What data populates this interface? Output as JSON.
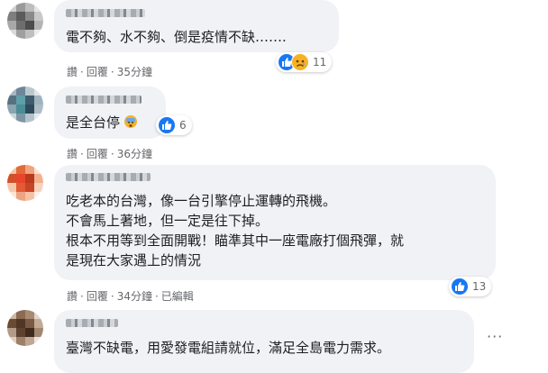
{
  "comments": [
    {
      "text_lines": [
        "電不夠、水不夠、倒是疫情不缺……."
      ],
      "actions": [
        "讚",
        "回覆",
        "35分鐘"
      ],
      "reaction_count": "11",
      "reaction_icons": [
        "like-icon",
        "sad-icon"
      ]
    },
    {
      "text_lines": [
        "是全台停"
      ],
      "inline_emoji": "wow-icon",
      "actions": [
        "讚",
        "回覆",
        "36分鐘"
      ],
      "reaction_count": "6",
      "reaction_icons": [
        "like-icon"
      ]
    },
    {
      "text_lines": [
        "吃老本的台灣，像一台引擎停止運轉的飛機。",
        "不會馬上著地，但一定是往下掉。",
        "根本不用等到全面開戰！瞄準其中一座電廠打個飛彈，就",
        "是現在大家遇上的情況"
      ],
      "actions": [
        "讚",
        "回覆",
        "34分鐘",
        "已編輯"
      ],
      "reaction_count": "13",
      "reaction_icons": [
        "like-icon"
      ]
    },
    {
      "text_lines": [
        "臺灣不缺電，用愛發電組請就位，滿足全島電力需求。"
      ],
      "more_label": "···"
    }
  ],
  "colors": {
    "bubble": "#f0f2f5",
    "like_blue": "#1877f2",
    "meta_gray": "#65676b",
    "emoji_yellow": "#f7b125"
  }
}
